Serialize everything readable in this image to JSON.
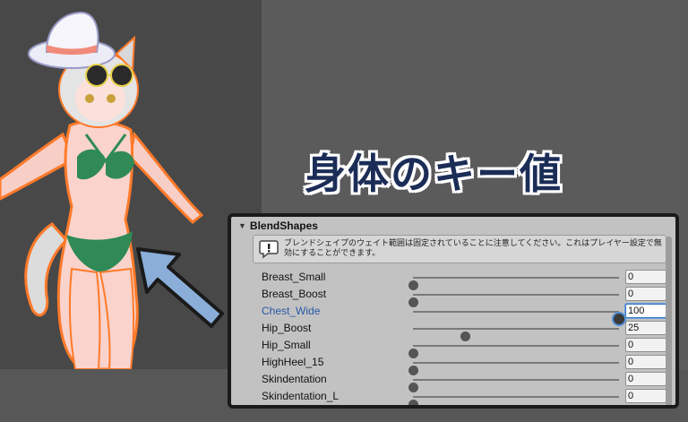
{
  "title": "身体のキー値",
  "panel": {
    "header": "BlendShapes",
    "notice": "ブレンドシェイプのウェイト範囲は固定されていることに注意してください。これはプレイヤー設定で無効にすることができます。"
  },
  "blendshapes": [
    {
      "label": "Breast_Small",
      "value": "0",
      "level": 0.0,
      "active": false
    },
    {
      "label": "Breast_Boost",
      "value": "0",
      "level": 0.0,
      "active": false
    },
    {
      "label": "Chest_Wide",
      "value": "100",
      "level": 1.0,
      "active": true
    },
    {
      "label": "Hip_Boost",
      "value": "25",
      "level": 0.25,
      "active": false
    },
    {
      "label": "Hip_Small",
      "value": "0",
      "level": 0.0,
      "active": false
    },
    {
      "label": "HighHeel_15",
      "value": "0",
      "level": 0.0,
      "active": false
    },
    {
      "label": "Skindentation",
      "value": "0",
      "level": 0.0,
      "active": false
    },
    {
      "label": "Skindentation_L",
      "value": "0",
      "level": 0.0,
      "active": false
    }
  ],
  "colors": {
    "title_text": "#1b2d57",
    "arrow_fill": "#8aaed8",
    "active_label": "#2858a8",
    "outline_orange": "#ff7a2a"
  }
}
